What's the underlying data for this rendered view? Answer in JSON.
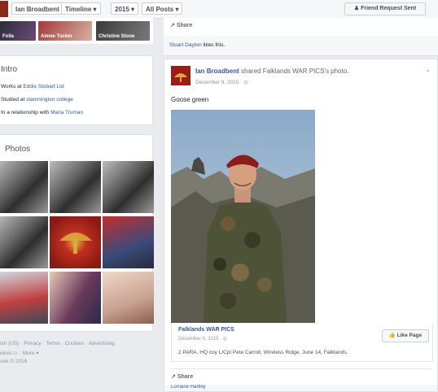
{
  "topbar": {
    "profile_name": "Ian Broadbent",
    "timeline_label": "Timeline",
    "year_label": "2015",
    "filter_label": "All Posts",
    "friend_request_label": "Friend Request Sent",
    "dropdown_caret": "▾",
    "person_glyph": "♟"
  },
  "friends_strip": [
    "Folla",
    "Aimee Tucker",
    "Christine Stone"
  ],
  "intro": {
    "title": "Intro",
    "rows": [
      {
        "prefix": "Works at ",
        "link": "Eddie Stobart Ltd"
      },
      {
        "prefix": "Studied at ",
        "link": "stanmington college"
      },
      {
        "prefix": "In a relationship with ",
        "link": "Marla Truman"
      }
    ]
  },
  "photos": {
    "title": "Photos"
  },
  "footer": {
    "line1": "ish (US) · Privacy · Terms · Cookies · Advertising",
    "line2": "oices ▷ · More ▾",
    "line3": "ook © 2016"
  },
  "top_post": {
    "share_label": "Share",
    "share_glyph": "↗",
    "likes_prefix": "Stuart Dayton",
    "likes_suffix": " likes this."
  },
  "post": {
    "author": "Ian Broadbent",
    "shared_text": " shared Falklands WAR PICS's photo.",
    "date": "December 9, 2015 · ",
    "globe": "◎",
    "chevron": "⌄",
    "message": "Goose green",
    "shared": {
      "title": "Falklands WAR PICS",
      "date": "December 9, 2015 · ◎",
      "caption": "2 PARA, HQ coy L/Cpl Pete Carroll, Wireless Ridge, June 14, Falklands.",
      "like_page_label": "Like Page",
      "like_glyph": "👍"
    },
    "share_label": "Share",
    "share_glyph": "↗",
    "bottom_text": "Lorraine Hartley"
  },
  "colors": {
    "accent": "#365899",
    "background": "#e9ebee"
  }
}
